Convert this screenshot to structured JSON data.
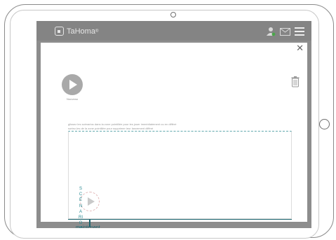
{
  "app": {
    "brand": "TaHoma",
    "brand_mark": "®"
  },
  "icons": {
    "logo": "house-icon",
    "user": "user-icon",
    "mail": "mail-icon",
    "menu": "menu-icon",
    "close": "close-icon",
    "trash": "trash-icon",
    "new_scenario": "play-icon",
    "ghost": "play-icon"
  },
  "colors": {
    "accent": "#1d6670",
    "accent_light": "#2a8a92",
    "topbar": "#848484",
    "user_dot": "#4aa64a"
  },
  "panel": {
    "close_label": "✕",
    "new_scenario_label": "Nouveau",
    "instructions_line1": "glissez les scénarios dans la zone pointillée pour les jouer immédiatement ou en différé",
    "instructions_line2": "sortez-les de la zone pointillée pour supprimer leur lancement différé",
    "now_label": "maintenant",
    "side_title": "SCÉNARIOS"
  }
}
